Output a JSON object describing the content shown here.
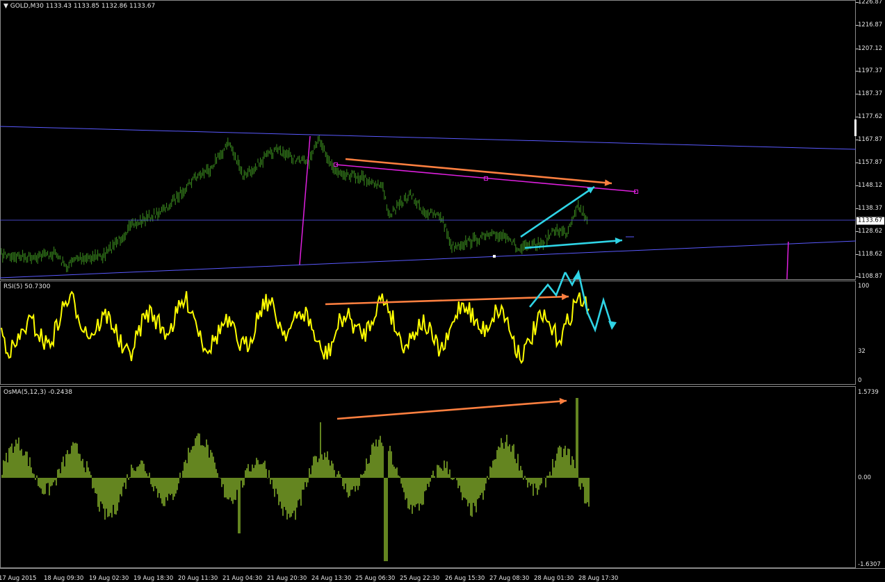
{
  "main_panel": {
    "title": "GOLD,M30  1133.43 1133.85 1132.86 1133.67",
    "current_price": "1133.67",
    "price_ticks": [
      "1226.87",
      "1216.87",
      "1207.12",
      "1197.37",
      "1187.37",
      "1177.62",
      "1167.87",
      "1157.87",
      "1148.12",
      "1138.37",
      "1128.62",
      "1118.62",
      "1108.87"
    ]
  },
  "rsi_panel": {
    "title": "RSI(5) 50.7300",
    "ticks": [
      "100",
      "32",
      "0"
    ]
  },
  "osma_panel": {
    "title": "OsMA(5,12,3) -0.2438",
    "ticks": [
      "1.5739",
      "0.00",
      "-1.6307"
    ]
  },
  "time_axis": [
    "17 Aug 2015",
    "18 Aug 09:30",
    "19 Aug 02:30",
    "19 Aug 18:30",
    "20 Aug 11:30",
    "21 Aug 04:30",
    "21 Aug 20:30",
    "24 Aug 13:30",
    "25 Aug 06:30",
    "25 Aug 22:30",
    "26 Aug 15:30",
    "27 Aug 08:30",
    "28 Aug 01:30",
    "28 Aug 17:30"
  ],
  "colors": {
    "price": "#3d8f1f",
    "rsi": "#ffff00",
    "osma": "#9acd32",
    "channel": "#5a5aff",
    "magenta": "#e020e0",
    "orange": "#ff8040",
    "cyan": "#2fd4e6"
  }
}
